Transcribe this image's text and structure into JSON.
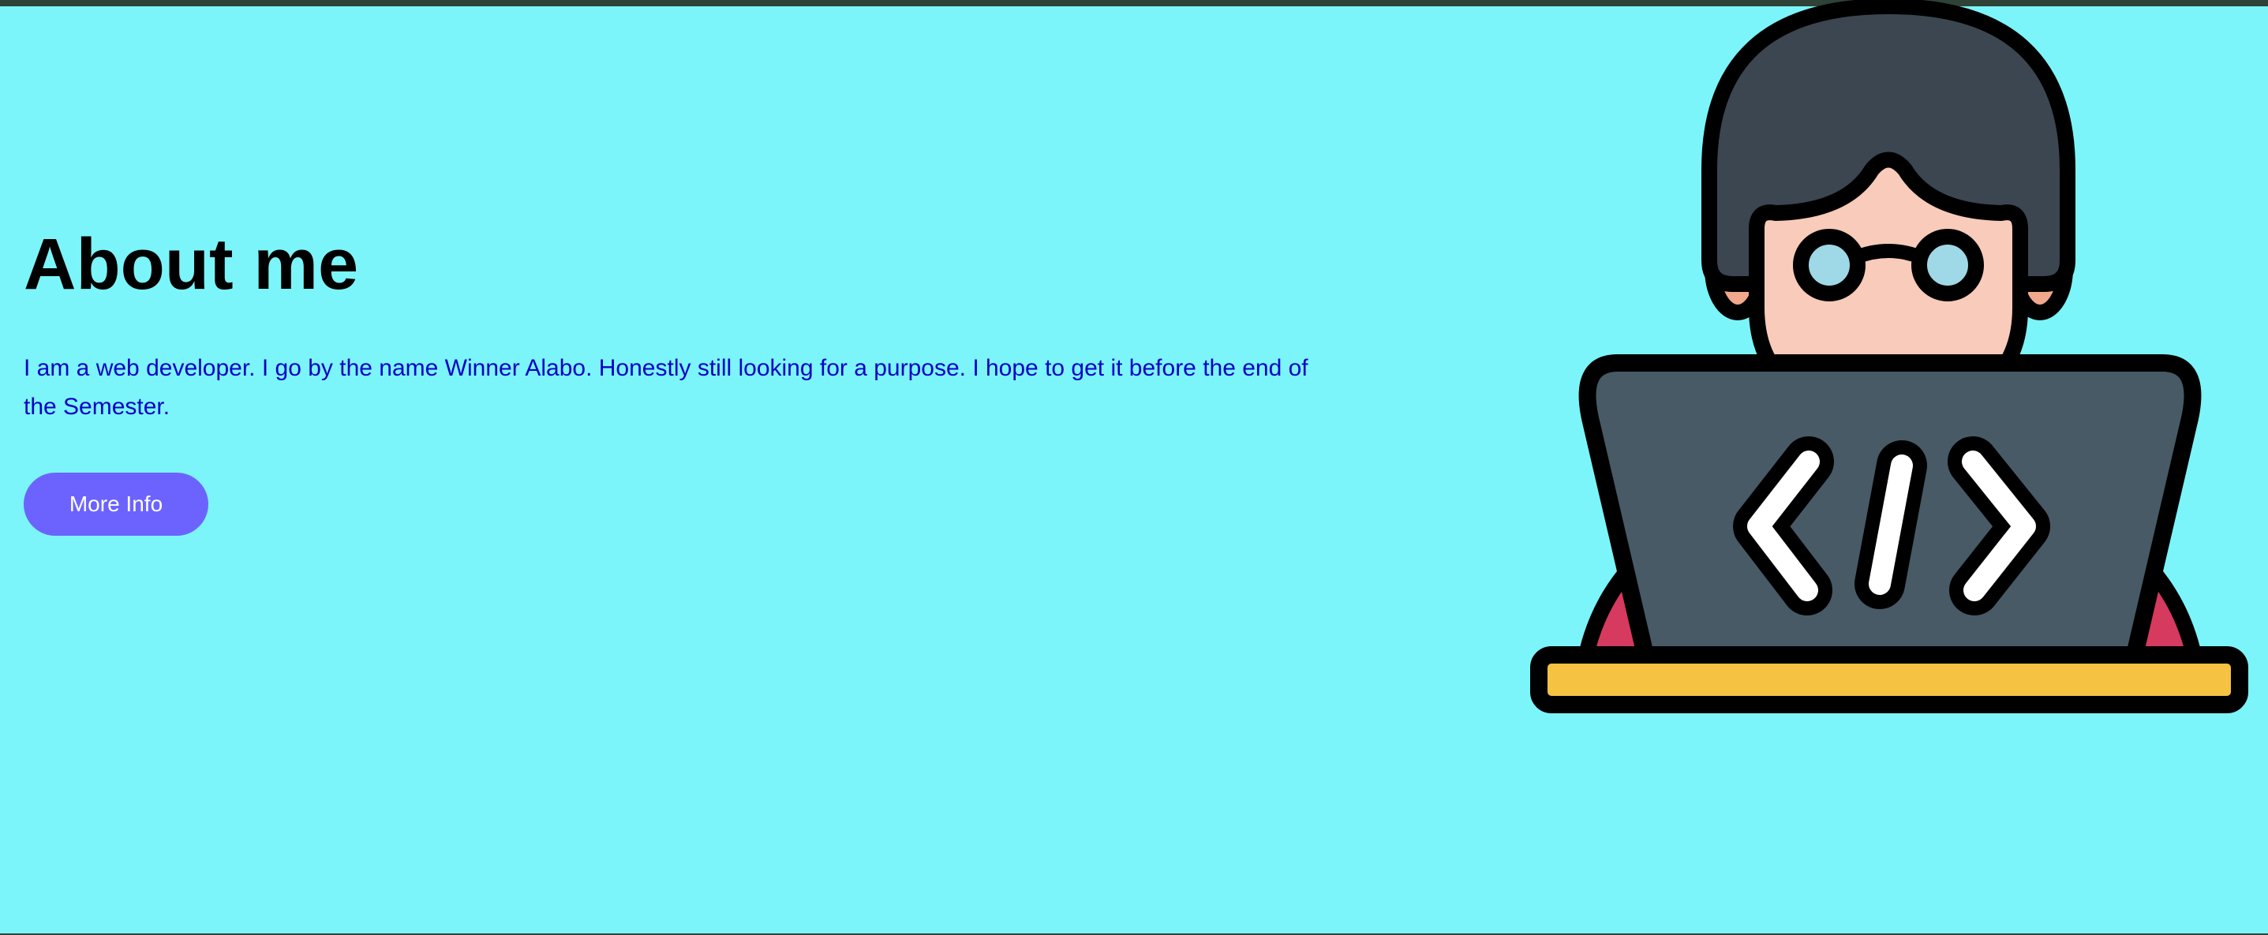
{
  "about": {
    "heading": "About me",
    "description": "I am a web developer. I go by the name Winner Alabo. Honestly still looking for a purpose. I hope to get it before the end of the Semester.",
    "button_label": "More Info"
  },
  "illustration": {
    "icon": "developer-coding-icon",
    "code_glyph": "</>"
  },
  "colors": {
    "background": "#7bf5f9",
    "heading": "#000000",
    "description": "#0b00c8",
    "button": "#6c63ff",
    "button_text": "#ffffff",
    "hair": "#3c4650",
    "skin": "#f8cbba",
    "ears": "#f1a98d",
    "glasses": "#9fd8e6",
    "laptop": "#475a66",
    "desk": "#f5c242",
    "shirt": "#d63a5e"
  }
}
